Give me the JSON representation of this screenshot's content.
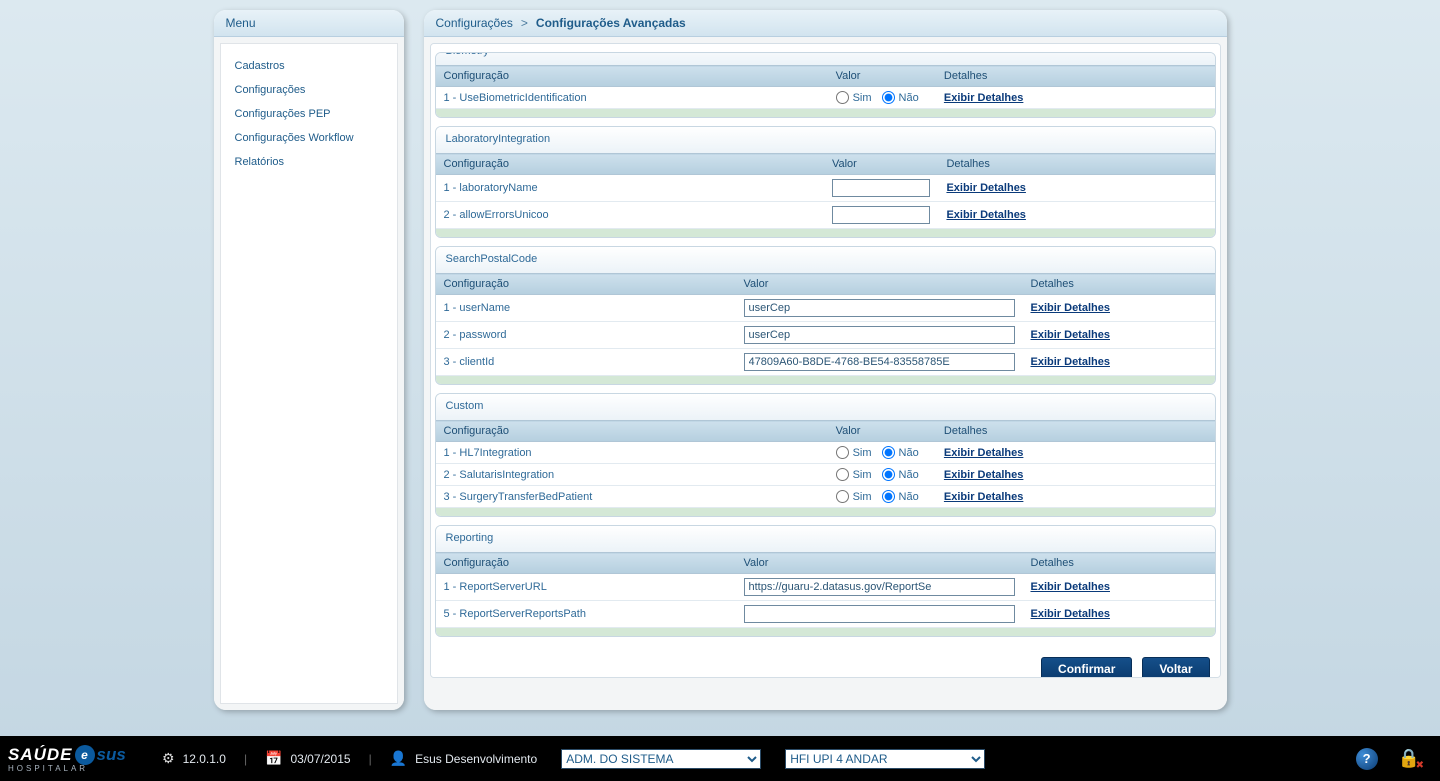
{
  "menu": {
    "title": "Menu",
    "items": [
      "Cadastros",
      "Configurações",
      "Configurações PEP",
      "Configurações Workflow",
      "Relatórios"
    ]
  },
  "breadcrumb": {
    "root": "Configurações",
    "sep": ">",
    "current": "Configurações Avançadas"
  },
  "labels": {
    "config": "Configuração",
    "valor": "Valor",
    "detalhes": "Detalhes",
    "sim": "Sim",
    "nao": "Não",
    "exibir": "Exibir Detalhes",
    "confirmar": "Confirmar",
    "voltar": "Voltar"
  },
  "groups": {
    "biometry": {
      "title": "Biometry",
      "rows": [
        {
          "label": "1 - UseBiometricIdentification",
          "type": "radio",
          "value": "nao"
        }
      ]
    },
    "lab": {
      "title": "LaboratoryIntegration",
      "rows": [
        {
          "label": "1 - laboratoryName",
          "type": "text",
          "value": ""
        },
        {
          "label": "2 - allowErrorsUnicoo",
          "type": "text",
          "value": ""
        }
      ]
    },
    "spc": {
      "title": "SearchPostalCode",
      "rows": [
        {
          "label": "1 - userName",
          "type": "text",
          "value": "userCep"
        },
        {
          "label": "2 - password",
          "type": "text",
          "value": "userCep"
        },
        {
          "label": "3 - clientId",
          "type": "text",
          "value": "47809A60-B8DE-4768-BE54-83558785E"
        }
      ]
    },
    "custom": {
      "title": "Custom",
      "rows": [
        {
          "label": "1 - HL7Integration",
          "type": "radio",
          "value": "nao"
        },
        {
          "label": "2 - SalutarisIntegration",
          "type": "radio",
          "value": "nao"
        },
        {
          "label": "3 - SurgeryTransferBedPatient",
          "type": "radio",
          "value": "nao"
        }
      ]
    },
    "reporting": {
      "title": "Reporting",
      "rows": [
        {
          "label": "1 - ReportServerURL",
          "type": "text",
          "value": "https://guaru-2.datasus.gov/ReportSe"
        },
        {
          "label": "5 - ReportServerReportsPath",
          "type": "text",
          "value": ""
        }
      ]
    }
  },
  "bottombar": {
    "version": "12.0.1.0",
    "date": "03/07/2015",
    "user": "Esus Desenvolvimento",
    "select1": "ADM. DO SISTEMA",
    "select2": "HFI UPI 4 ANDAR"
  },
  "logo": {
    "a": "SAÚDE",
    "b": "e",
    "c": "sus",
    "sub": "HOSPITALAR"
  }
}
